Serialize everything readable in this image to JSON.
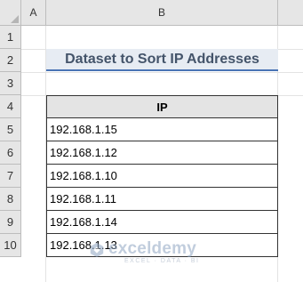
{
  "columns": [
    "A",
    "B"
  ],
  "rows": [
    "1",
    "2",
    "3",
    "4",
    "5",
    "6",
    "7",
    "8",
    "9",
    "10"
  ],
  "title": "Dataset to Sort IP Addresses",
  "table": {
    "header": "IP",
    "cells": [
      "192.168.1.15",
      "192.168.1.12",
      "192.168.1.10",
      "192.168.1.11",
      "192.168.1.14",
      "192.168.1.13"
    ]
  },
  "watermark": {
    "name": "exceldemy",
    "tagline": "EXCEL · DATA · BI"
  }
}
